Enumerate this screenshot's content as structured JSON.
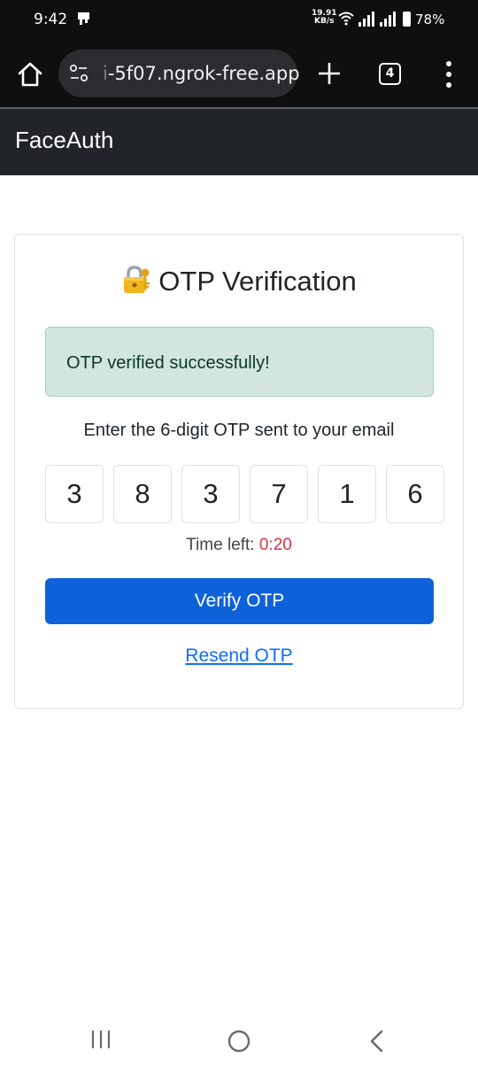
{
  "status_bar": {
    "time": "9:42",
    "speed_value": "19.91",
    "speed_unit": "KB/s",
    "battery": "78%"
  },
  "browser": {
    "url_prefix": "i",
    "url": "-5f07.ngrok-free.app",
    "tab_count": "4"
  },
  "navbar": {
    "brand": "FaceAuth"
  },
  "card": {
    "title": "OTP Verification",
    "alert": "OTP verified successfully!",
    "instruction": "Enter the 6-digit OTP sent to your email",
    "otp_digits": [
      "3",
      "8",
      "3",
      "7",
      "1",
      "6"
    ],
    "timer_label": "Time left:",
    "timer_value": "0:20",
    "verify_label": "Verify OTP",
    "resend_label": "Resend OTP"
  },
  "colors": {
    "primary": "#0d62d9",
    "success_bg": "#d1e7dd",
    "danger": "#dc3545",
    "navbar_bg": "#212529"
  },
  "icons": {
    "title_icon": "locked-with-key-icon"
  }
}
